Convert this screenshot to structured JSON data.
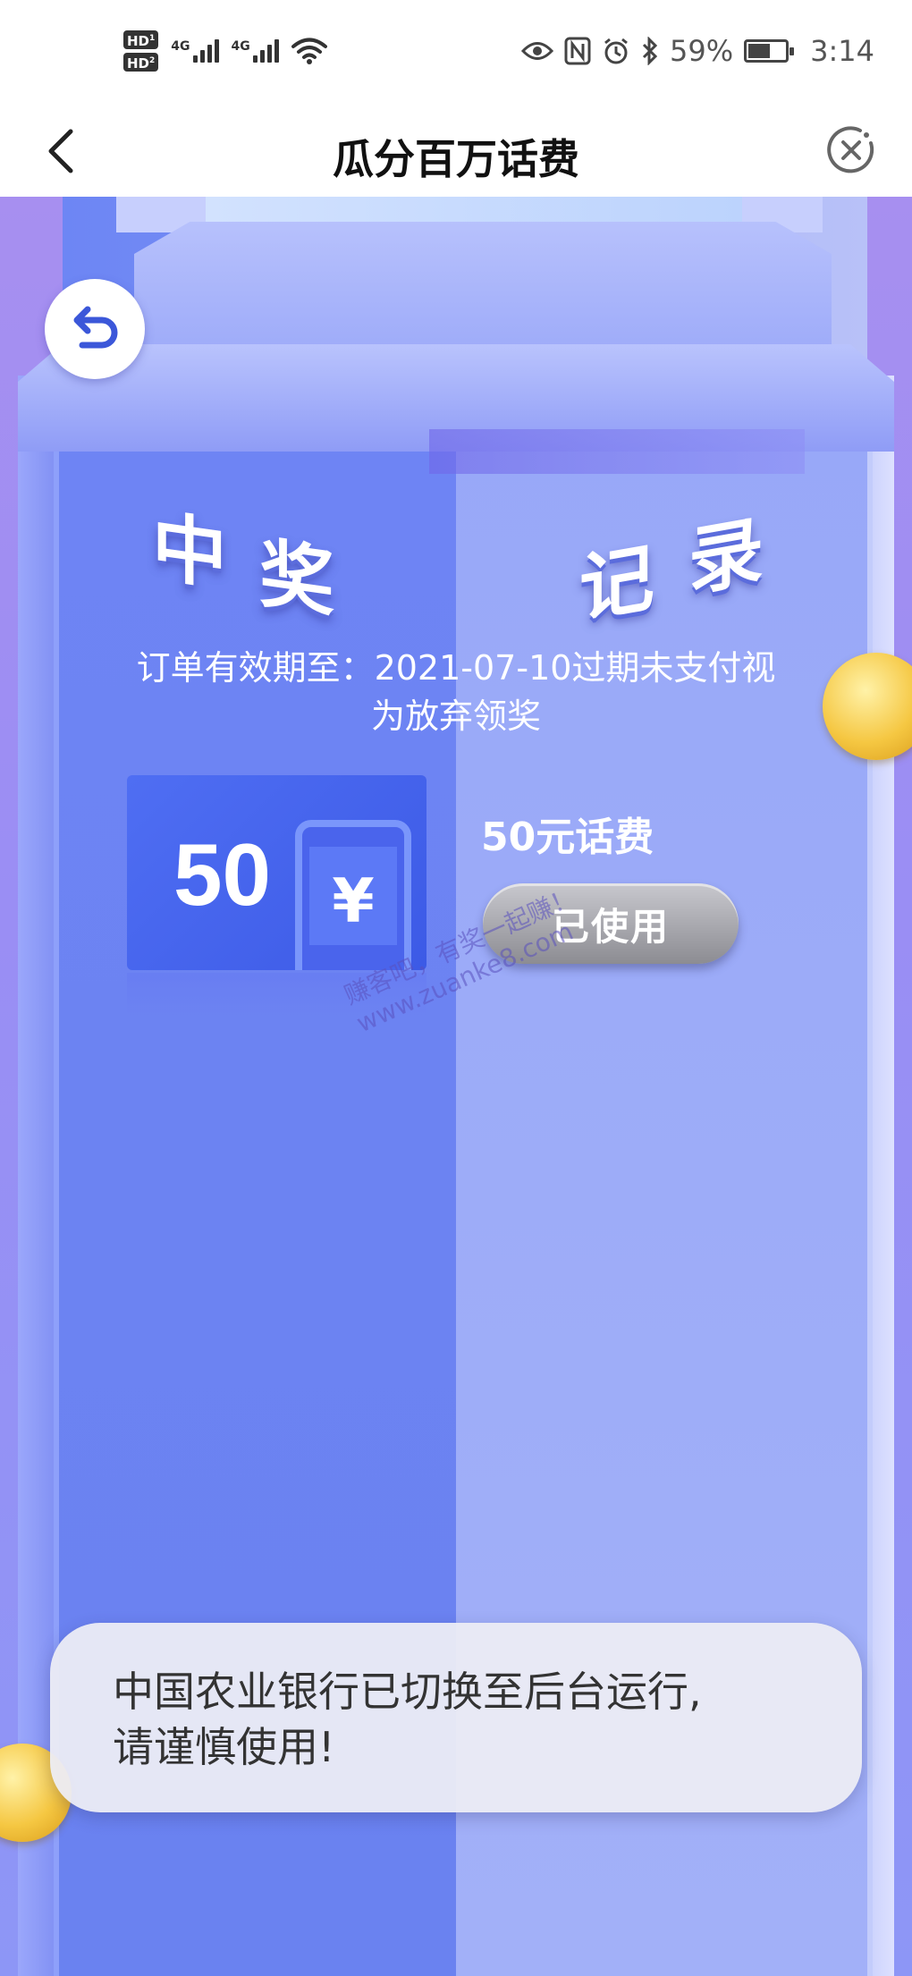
{
  "status_bar": {
    "hd1": "HD",
    "hd1_sub": "1",
    "hd2": "HD",
    "hd2_sub": "2",
    "net1": "4G",
    "net2": "4G",
    "battery_percent": "59%",
    "battery_level": 0.59,
    "time": "3:14",
    "icons": [
      "hd-icon",
      "signal-icon",
      "wifi-icon",
      "eye-icon",
      "nfc-icon",
      "alarm-icon",
      "bluetooth-icon",
      "battery-icon"
    ]
  },
  "nav": {
    "title": "瓜分百万话费",
    "back_icon": "chevron-left-icon",
    "close_icon": "close-circle-icon"
  },
  "page": {
    "heading_1a": "中",
    "heading_1b": "奖",
    "heading_2a": "记",
    "heading_2b": "录",
    "validity_line1": "订单有效期至：2021-07-10过期未支付视",
    "validity_line2": "为放弃领奖",
    "prize": {
      "amount": "50",
      "currency_symbol": "¥",
      "name": "50元话费",
      "status_button": "已使用"
    },
    "watermark_line1": "赚客吧，有奖一起赚！",
    "watermark_line2": "www.zuanke8.com"
  },
  "toast": {
    "line1": "中国农业银行已切换至后台运行,",
    "line2": "请谨慎使用!"
  },
  "colors": {
    "primary_blue": "#4f6ef3",
    "pillar_light": "#a2b0f8",
    "coin_gold": "#f5c742",
    "button_gray": "#9a9aa0"
  }
}
